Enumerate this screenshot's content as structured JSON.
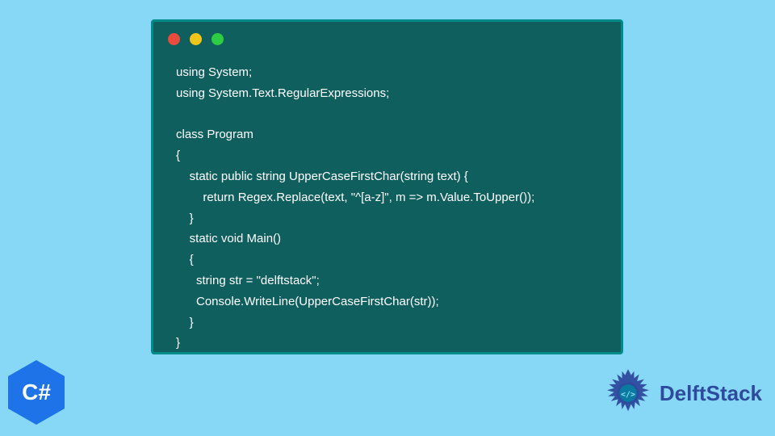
{
  "code": {
    "lines": [
      "using System;",
      "using System.Text.RegularExpressions;",
      "",
      "class Program",
      "{",
      "    static public string UpperCaseFirstChar(string text) {",
      "        return Regex.Replace(text, \"^[a-z]\", m => m.Value.ToUpper());",
      "    }",
      "    static void Main()",
      "    {",
      "      string str = \"delftstack\";",
      "      Console.WriteLine(UpperCaseFirstChar(str));",
      "    }",
      "}"
    ]
  },
  "badge": {
    "label": "C#"
  },
  "brand": {
    "name": "DelftStack"
  },
  "colors": {
    "background": "#87d8f6",
    "window_bg": "#0f5f5f",
    "window_border": "#008b8b",
    "traffic_red": "#e94b3c",
    "traffic_yellow": "#f0c419",
    "traffic_green": "#2ecc40",
    "badge_bg": "#1e73e9",
    "brand_text": "#2e4a9e"
  }
}
